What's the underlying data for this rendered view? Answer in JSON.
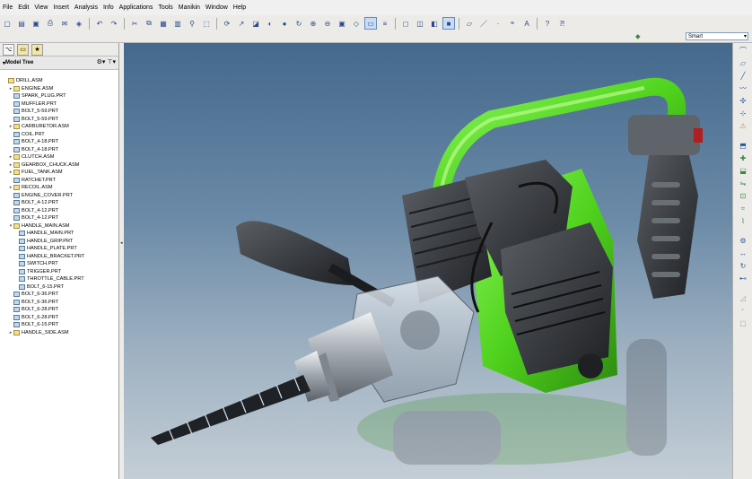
{
  "menubar": {
    "items": [
      "File",
      "Edit",
      "View",
      "Insert",
      "Analysis",
      "Info",
      "Applications",
      "Tools",
      "Manikin",
      "Window",
      "Help"
    ]
  },
  "toolbar": {
    "icons": [
      "new-file-icon",
      "open-folder-icon",
      "save-icon",
      "print-icon",
      "email-icon",
      "model-icon",
      "sep",
      "undo-icon",
      "redo-icon",
      "sep",
      "cut-icon",
      "copy-icon",
      "paste-icon",
      "paste-special-icon",
      "find-icon",
      "select-box-icon",
      "sep",
      "regenerate-icon",
      "datum-icon",
      "feature-icon",
      "appearance-icon",
      "render-icon",
      "spin-icon",
      "zoom-in-icon",
      "zoom-out-icon",
      "refit-icon",
      "orient-icon",
      "saved-views-icon",
      "layers-icon",
      "sep",
      "wireframe-icon",
      "hidden-line-icon",
      "no-hidden-icon",
      "shaded-icon",
      "sep",
      "datum-planes-icon",
      "datum-axes-icon",
      "datum-points-icon",
      "csys-icon",
      "annotation-icon",
      "sep",
      "help-icon",
      "context-help-icon"
    ]
  },
  "filter": {
    "selected": "Smart"
  },
  "left_panel": {
    "tabs": [
      "model-tree-tab",
      "folder-browser-tab",
      "favorites-tab"
    ],
    "header_title": "Model Tree",
    "tree": [
      {
        "label": "DRILL.ASM",
        "type": "asm",
        "indent": 0,
        "expander": ""
      },
      {
        "label": "ENGINE.ASM",
        "type": "asm",
        "indent": 1,
        "expander": "▸"
      },
      {
        "label": "SPARK_PLUG.PRT",
        "type": "prt",
        "indent": 1,
        "expander": ""
      },
      {
        "label": "MUFFLER.PRT",
        "type": "prt",
        "indent": 1,
        "expander": ""
      },
      {
        "label": "BOLT_5-59.PRT",
        "type": "prt",
        "indent": 1,
        "expander": ""
      },
      {
        "label": "BOLT_5-59.PRT",
        "type": "prt",
        "indent": 1,
        "expander": ""
      },
      {
        "label": "CARBURETOR.ASM",
        "type": "asm",
        "indent": 1,
        "expander": "▸"
      },
      {
        "label": "COIL.PRT",
        "type": "prt",
        "indent": 1,
        "expander": ""
      },
      {
        "label": "BOLT_4-18.PRT",
        "type": "prt",
        "indent": 1,
        "expander": ""
      },
      {
        "label": "BOLT_4-18.PRT",
        "type": "prt",
        "indent": 1,
        "expander": ""
      },
      {
        "label": "CLUTCH.ASM",
        "type": "asm",
        "indent": 1,
        "expander": "▸"
      },
      {
        "label": "GEARBOX_CHUCK.ASM",
        "type": "asm",
        "indent": 1,
        "expander": "▸"
      },
      {
        "label": "FUEL_TANK.ASM",
        "type": "asm",
        "indent": 1,
        "expander": "▸"
      },
      {
        "label": "RATCHET.PRT",
        "type": "prt",
        "indent": 1,
        "expander": ""
      },
      {
        "label": "RECOIL.ASM",
        "type": "asm",
        "indent": 1,
        "expander": "▸"
      },
      {
        "label": "ENGINE_COVER.PRT",
        "type": "prt",
        "indent": 1,
        "expander": ""
      },
      {
        "label": "BOLT_4-12.PRT",
        "type": "prt",
        "indent": 1,
        "expander": ""
      },
      {
        "label": "BOLT_4-12.PRT",
        "type": "prt",
        "indent": 1,
        "expander": ""
      },
      {
        "label": "BOLT_4-12.PRT",
        "type": "prt",
        "indent": 1,
        "expander": ""
      },
      {
        "label": "HANDLE_MAIN.ASM",
        "type": "asm",
        "indent": 1,
        "expander": "▾"
      },
      {
        "label": "HANDLE_MAIN.PRT",
        "type": "prt",
        "indent": 2,
        "expander": ""
      },
      {
        "label": "HANDLE_GRIP.PRT",
        "type": "prt",
        "indent": 2,
        "expander": ""
      },
      {
        "label": "HANDLE_PLATE.PRT",
        "type": "prt",
        "indent": 2,
        "expander": ""
      },
      {
        "label": "HANDLE_BRACKET.PRT",
        "type": "prt",
        "indent": 2,
        "expander": ""
      },
      {
        "label": "SWITCH.PRT",
        "type": "prt",
        "indent": 2,
        "expander": ""
      },
      {
        "label": "TRIGGER.PRT",
        "type": "prt",
        "indent": 2,
        "expander": ""
      },
      {
        "label": "THROTTLE_CABLE.PRT",
        "type": "prt",
        "indent": 2,
        "expander": ""
      },
      {
        "label": "BOLT_6-15.PRT",
        "type": "prt",
        "indent": 2,
        "expander": ""
      },
      {
        "label": "BOLT_6-36.PRT",
        "type": "prt",
        "indent": 1,
        "expander": ""
      },
      {
        "label": "BOLT_6-36.PRT",
        "type": "prt",
        "indent": 1,
        "expander": ""
      },
      {
        "label": "BOLT_6-28.PRT",
        "type": "prt",
        "indent": 1,
        "expander": ""
      },
      {
        "label": "BOLT_6-28.PRT",
        "type": "prt",
        "indent": 1,
        "expander": ""
      },
      {
        "label": "BOLT_6-15.PRT",
        "type": "prt",
        "indent": 1,
        "expander": ""
      },
      {
        "label": "HANDLE_SIDE.ASM",
        "type": "asm",
        "indent": 1,
        "expander": "▸"
      }
    ]
  },
  "right_toolbar": {
    "icons": [
      "datum-plane-icon",
      "datum-axis-icon",
      "datum-curve-icon",
      "sketch-icon",
      "datum-point-icon",
      "csys-icon",
      "analysis-icon",
      "sep",
      "component-icon",
      "create-icon",
      "pattern-icon",
      "mirror-icon",
      "measure-icon",
      "cable-icon",
      "harness-icon",
      "sep",
      "mechanism-icon",
      "joint-icon",
      "motor-icon",
      "connection-icon",
      "sep",
      "draft-icon",
      "round-icon",
      "shell-icon"
    ]
  },
  "colors": {
    "accent_green": "#4fd21d",
    "body_dark": "#2f3236",
    "bg_top": "#44698d",
    "bg_bottom": "#c4ced6"
  }
}
